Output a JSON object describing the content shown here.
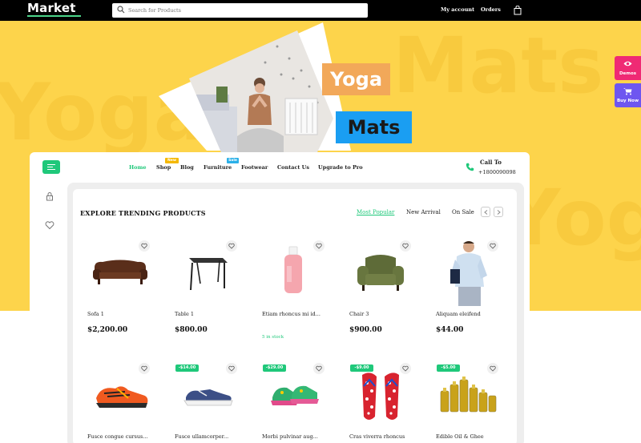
{
  "app": {
    "logo": "Market"
  },
  "search": {
    "placeholder": "Search for Products"
  },
  "top_nav": {
    "my_account": "My account",
    "orders": "Orders"
  },
  "hero": {
    "watermark_left": "Yoga",
    "watermark_right": "Mats",
    "watermark_lower": "Yoga",
    "tag_1": "Yoga",
    "tag_2": "Mats"
  },
  "side_buttons": {
    "demos": "Demos",
    "buy_now": "Buy Now"
  },
  "nav": {
    "items": [
      "Home",
      "Shop",
      "Blog",
      "Furniture",
      "Footwear",
      "Contact Us",
      "Upgrade to Pro"
    ],
    "badge_new": "New",
    "badge_sale": "Sale"
  },
  "call": {
    "title": "Call To",
    "number": "+1800090098"
  },
  "section": {
    "title": "EXPLORE TRENDING PRODUCTS",
    "tabs": [
      "Most Popular",
      "New Arrival",
      "On Sale"
    ]
  },
  "products_row1": [
    {
      "name": "Sofa 1",
      "price": "$2,200.00",
      "icon": "sofa"
    },
    {
      "name": "Table 1",
      "price": "$800.00",
      "icon": "table"
    },
    {
      "name": "Etiam rhoncus mi id...",
      "price": "",
      "stock": "5 in stock",
      "icon": "bottle"
    },
    {
      "name": "Chair 3",
      "price": "$900.00",
      "icon": "armchair"
    },
    {
      "name": "Aliquam eleifend",
      "price": "$44.00",
      "icon": "man-in-shirt"
    }
  ],
  "products_row2": [
    {
      "name": "Fusce congue cursus...",
      "discount": "",
      "icon": "running-shoe"
    },
    {
      "name": "Fusce ullamcorper...",
      "discount": "-$14.00",
      "icon": "sneaker"
    },
    {
      "name": "Morbi pulvinar aug...",
      "discount": "-$29.00",
      "icon": "kids-shoes"
    },
    {
      "name": "Cras viverra rhoncus",
      "discount": "-$9.00",
      "icon": "flip-flops"
    },
    {
      "name": "Edible Oil & Ghee",
      "discount": "-$5.00",
      "icon": "oil-bottles"
    }
  ],
  "colors": {
    "accent": "#1fc87a",
    "hero_bg": "#fdd44b",
    "demos": "#ef2a74",
    "buy_now": "#6e56f0"
  }
}
